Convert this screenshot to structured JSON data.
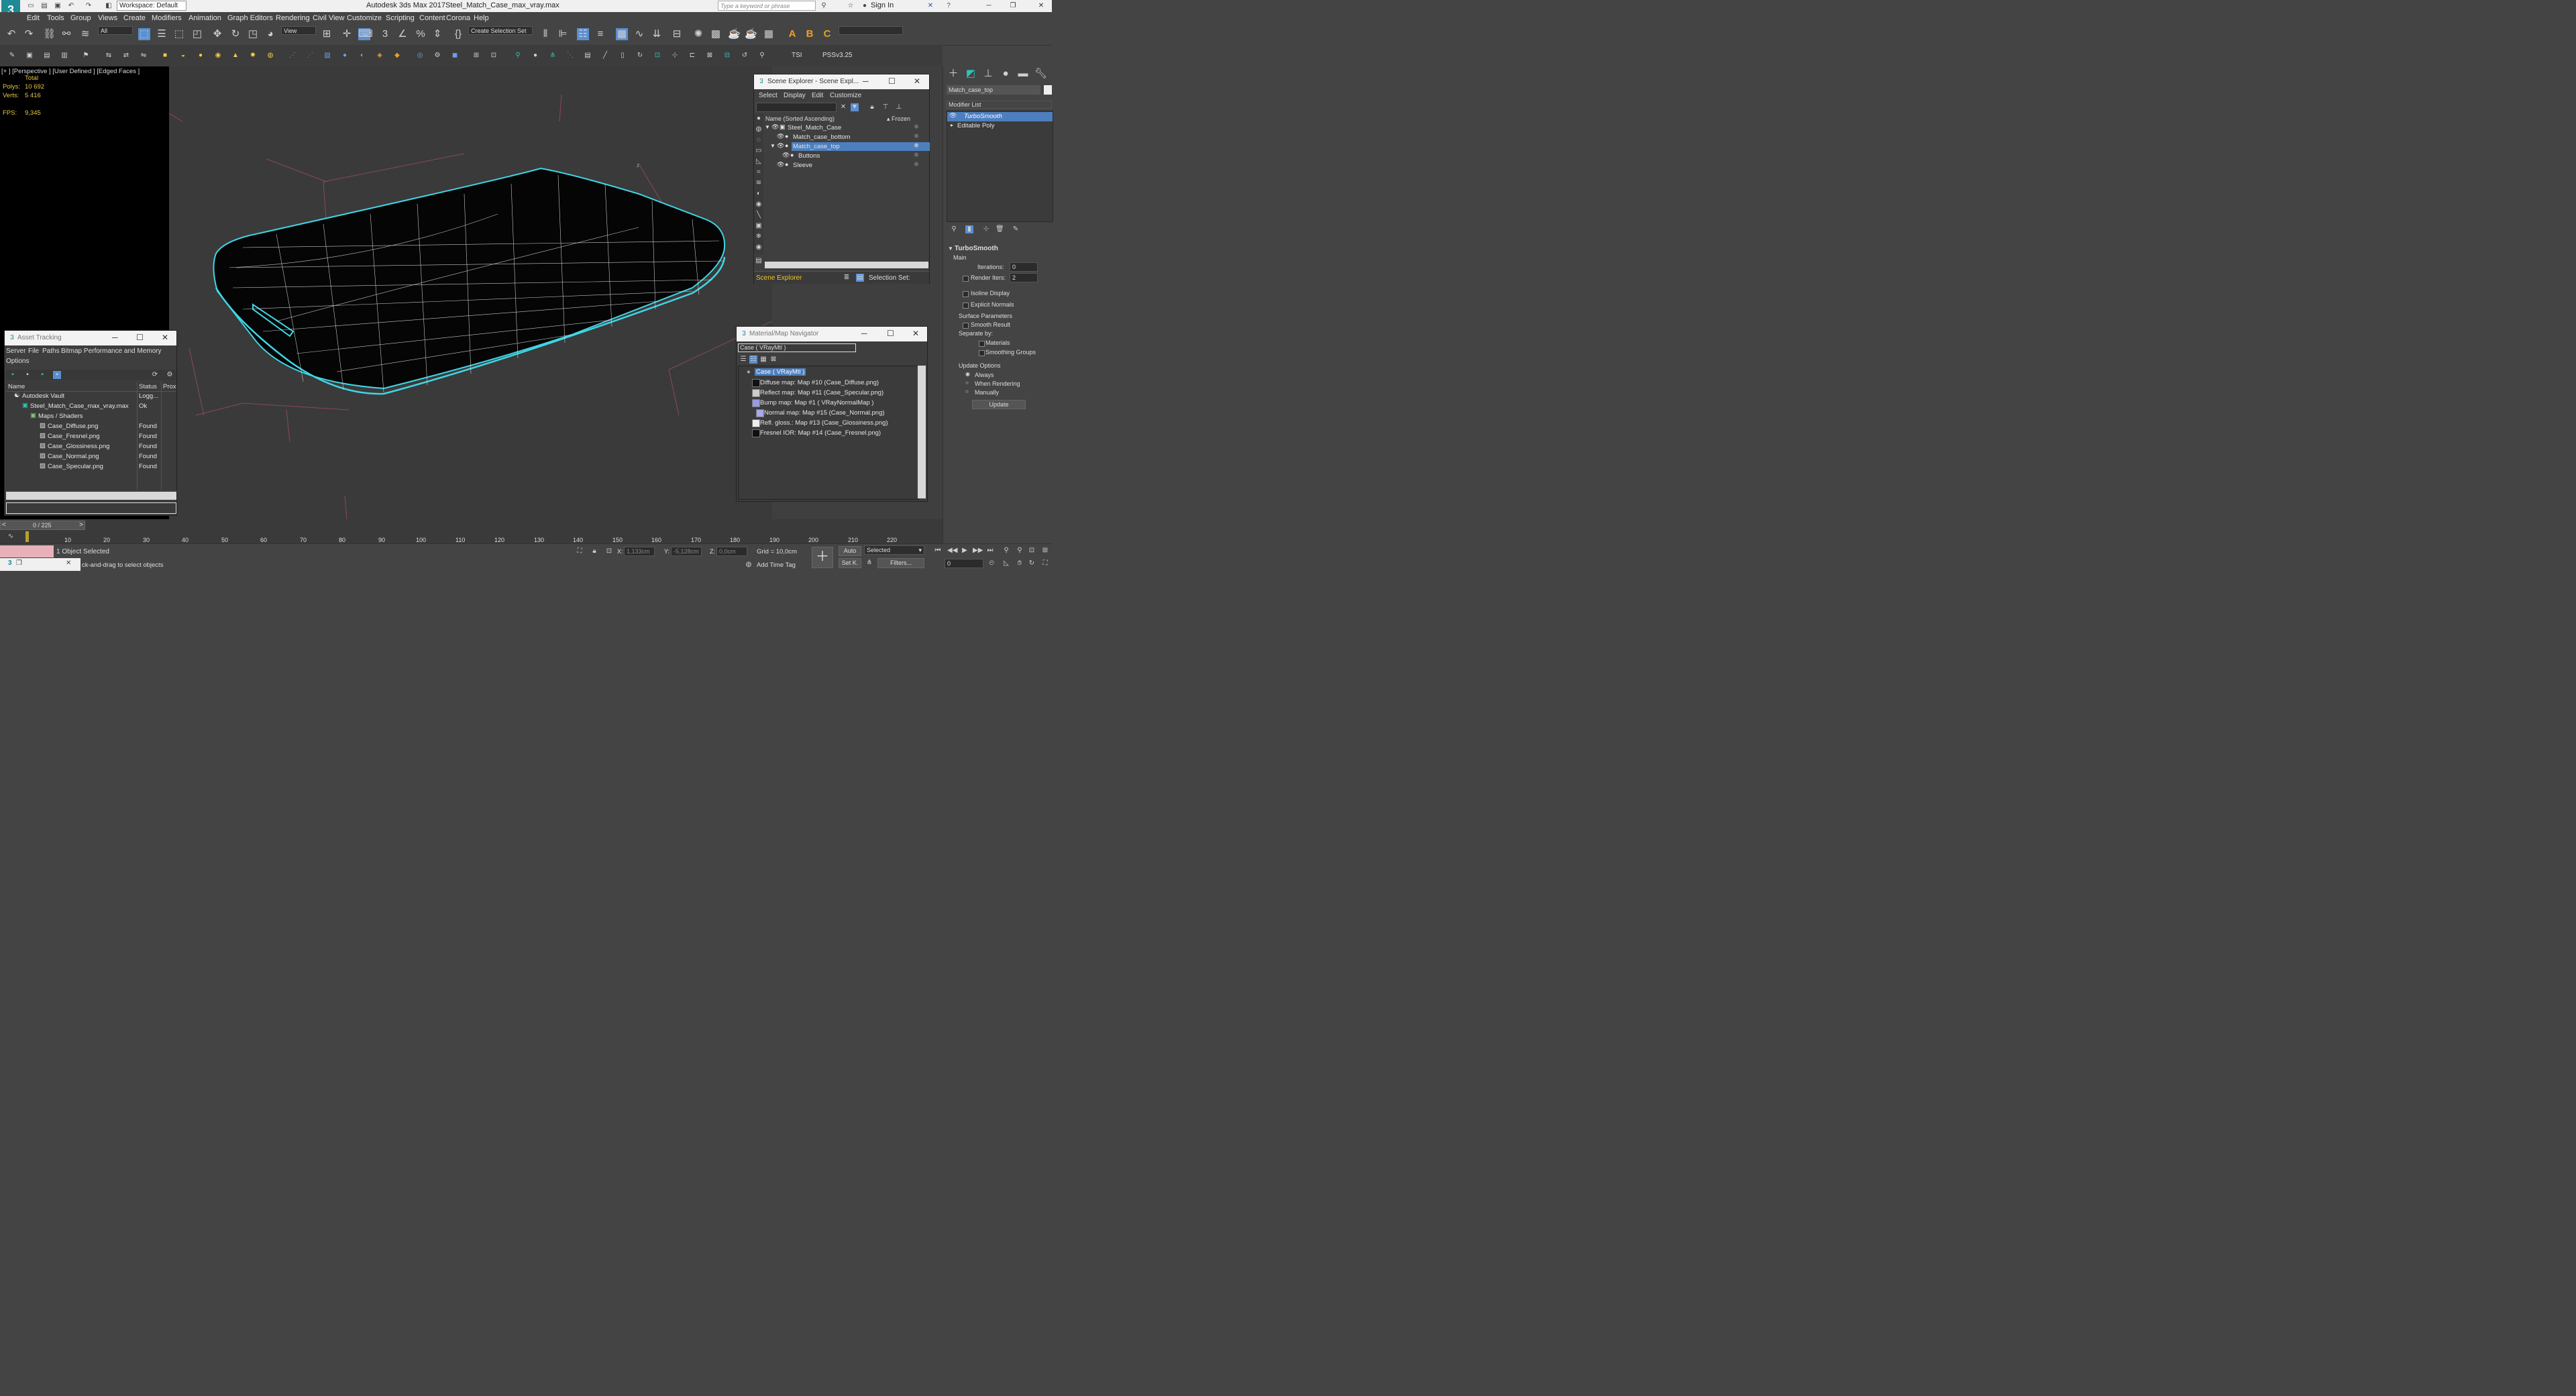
{
  "app": {
    "title": "Autodesk 3ds Max 2017",
    "file": "Steel_Match_Case_max_vray.max",
    "workspace": "Workspace: Default",
    "search_placeholder": "Type a keyword or phrase",
    "sign_in": "Sign In"
  },
  "menu": [
    "Edit",
    "Tools",
    "Group",
    "Views",
    "Create",
    "Modifiers",
    "Animation",
    "Graph Editors",
    "Rendering",
    "Civil View",
    "Customize",
    "Scripting",
    "Content",
    "Corona",
    "Help"
  ],
  "toolbar": {
    "filter": "All",
    "view": "View",
    "selection_set": "Create Selection Set",
    "tsi": "TSI",
    "pss": "PSSv3.25"
  },
  "viewport": {
    "label": "[+ ] [Perspective ]  [User Defined ]  [Edged Faces ]",
    "stats_title": "Total",
    "polys_label": "Polys:",
    "polys": "10 692",
    "verts_label": "Verts:",
    "verts": "5 416",
    "fps_label": "FPS:",
    "fps": "9,345",
    "axis_z": "z"
  },
  "scene_explorer": {
    "title": "Scene Explorer - Scene Expl...",
    "menu": [
      "Select",
      "Display",
      "Edit",
      "Customize"
    ],
    "col_name": "Name (Sorted Ascending)",
    "col_frozen": "▴ Frozen",
    "items": [
      {
        "name": "Steel_Match_Case",
        "indent": 0,
        "selected": false
      },
      {
        "name": "Match_case_bottom",
        "indent": 1,
        "selected": false
      },
      {
        "name": "Match_case_top",
        "indent": 1,
        "selected": true
      },
      {
        "name": "Buttons",
        "indent": 2,
        "selected": false
      },
      {
        "name": "Sleeve",
        "indent": 1,
        "selected": false
      }
    ],
    "footer": "Scene Explorer",
    "selection_set": "Selection Set:"
  },
  "asset_tracking": {
    "title": "Asset Tracking",
    "menu": [
      "Server",
      "File",
      "Paths",
      "Bitmap Performance and Memory"
    ],
    "menu2": "Options",
    "col_name": "Name",
    "col_status": "Status",
    "col_prox": "Prox",
    "rows": [
      {
        "name": "Autodesk Vault",
        "status": "Logg...",
        "indent": 0
      },
      {
        "name": "Steel_Match_Case_max_vray.max",
        "status": "Ok",
        "indent": 1
      },
      {
        "name": "Maps / Shaders",
        "status": "",
        "indent": 2
      },
      {
        "name": "Case_Diffuse.png",
        "status": "Found",
        "indent": 3
      },
      {
        "name": "Case_Fresnel.png",
        "status": "Found",
        "indent": 3
      },
      {
        "name": "Case_Glossiness.png",
        "status": "Found",
        "indent": 3
      },
      {
        "name": "Case_Normal.png",
        "status": "Found",
        "indent": 3
      },
      {
        "name": "Case_Specular.png",
        "status": "Found",
        "indent": 3
      }
    ]
  },
  "material_nav": {
    "title": "Material/Map Navigator",
    "current": "Case  ( VRayMtl )",
    "root": "Case  ( VRayMtl )",
    "items": [
      {
        "label": "Diffuse map: Map #10 (Case_Diffuse.png)",
        "color": "#111111",
        "indent": 0
      },
      {
        "label": "Reflect map: Map #11 (Case_Specular.png)",
        "color": "#cccccc",
        "indent": 0
      },
      {
        "label": "Bump map: Map #1  ( VRayNormalMap )",
        "color": "#9a9ae6",
        "indent": 0
      },
      {
        "label": "Normal map: Map #15 (Case_Normal.png)",
        "color": "#a8a8ee",
        "indent": 1
      },
      {
        "label": "Refl. gloss.: Map #13 (Case_Glossiness.png)",
        "color": "#eeeeee",
        "indent": 0
      },
      {
        "label": "Fresnel IOR: Map #14 (Case_Fresnel.png)",
        "color": "#111111",
        "indent": 0
      }
    ]
  },
  "command_panel": {
    "object_name": "Match_case_top",
    "modifier_list": "Modifier List",
    "stack": [
      "TurboSmooth",
      "Editable Poly"
    ],
    "rollout": "TurboSmooth",
    "main": "Main",
    "iterations_label": "Iterations:",
    "iterations": "0",
    "render_iters_label": "Render Iters:",
    "render_iters": "2",
    "isoline": "Isoline Display",
    "explicit": "Explicit Normals",
    "surface": "Surface Parameters",
    "smooth_result": "Smooth Result",
    "separate": "Separate by:",
    "materials": "Materials",
    "smoothing": "Smoothing Groups",
    "update_options": "Update Options",
    "always": "Always",
    "when_rendering": "When Rendering",
    "manually": "Manually",
    "update": "Update"
  },
  "timeline": {
    "frame": "0 / 225",
    "ticks": [
      "10",
      "20",
      "30",
      "40",
      "50",
      "60",
      "70",
      "80",
      "90",
      "100",
      "110",
      "120",
      "130",
      "140",
      "150",
      "160",
      "170",
      "180",
      "190",
      "200",
      "210",
      "220"
    ]
  },
  "status": {
    "selected": "1 Object Selected",
    "prompt": "ck-and-drag to select objects",
    "x_label": "X:",
    "x": "1,133cm",
    "y_label": "Y:",
    "y": "-5,128cm",
    "z_label": "Z:",
    "z": "0,0cm",
    "grid": "Grid = 10,0cm",
    "add_time_tag": "Add Time Tag",
    "auto": "Auto",
    "set_key": "Set K.",
    "selected_dd": "Selected",
    "filters": "Filters...",
    "frame_field": "0"
  },
  "colors": {
    "accent": "#4d7fbf",
    "selection_outline": "#3fd6e6",
    "scene_footer": "#f5c518"
  }
}
